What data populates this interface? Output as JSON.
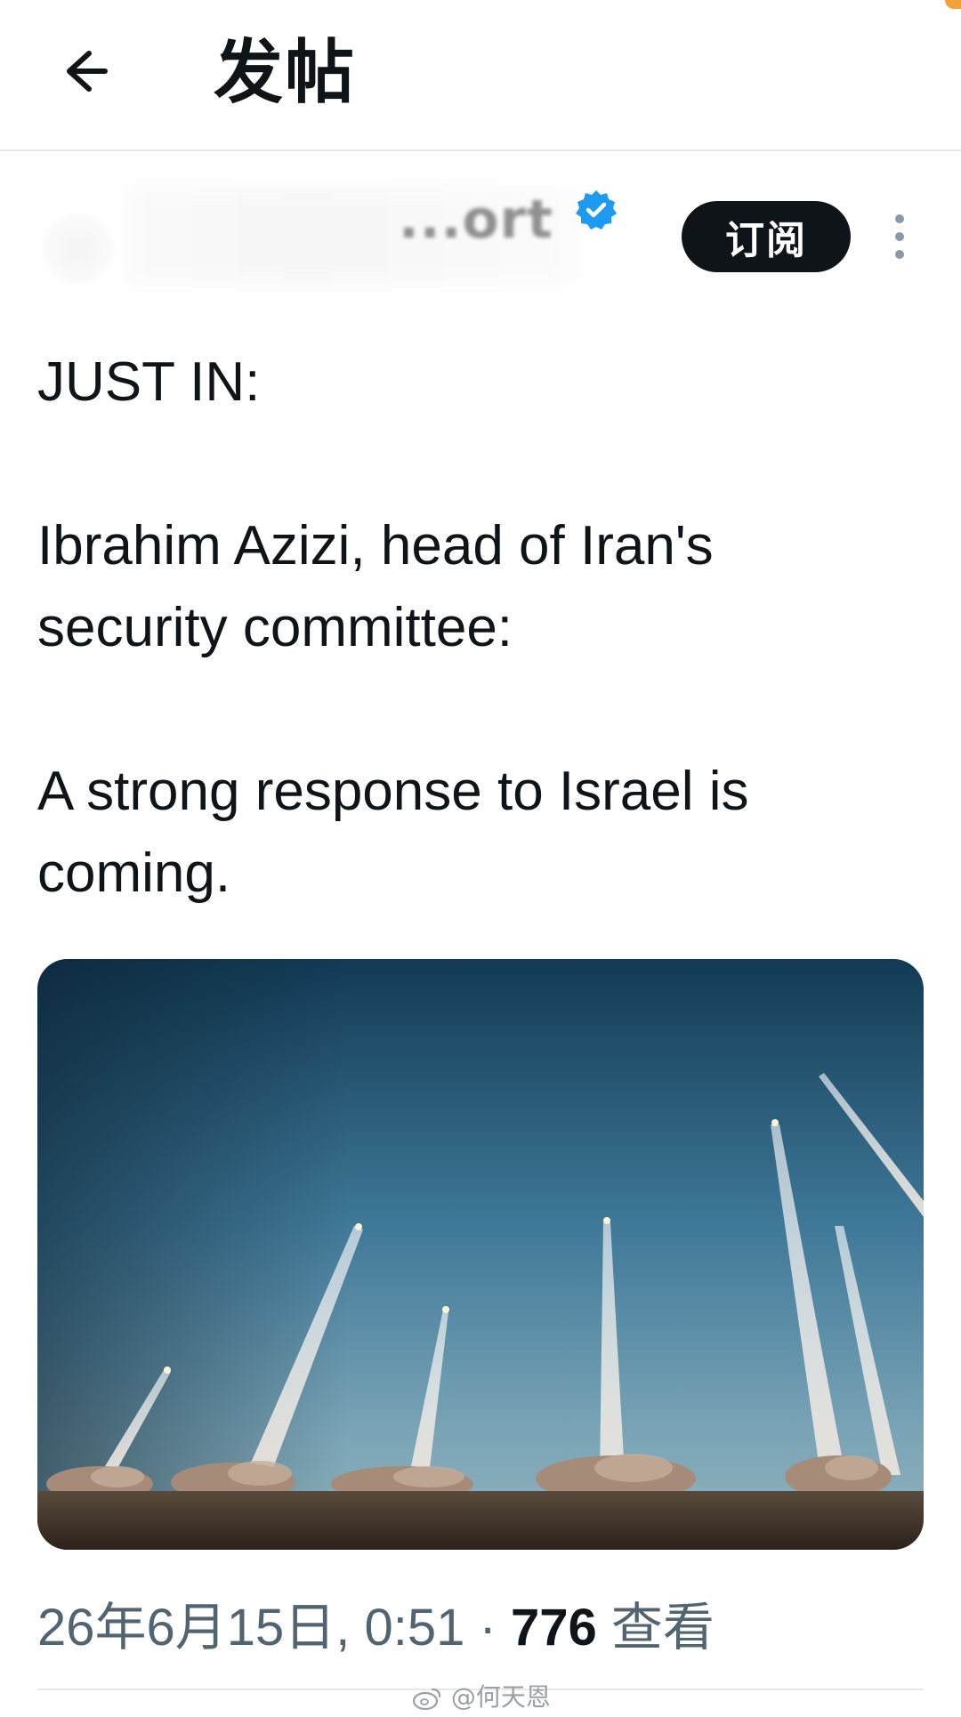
{
  "header": {
    "title": "发帖",
    "back_icon": "arrow-left-icon"
  },
  "author": {
    "display_name": "...ort",
    "verified_icon": "verified-badge-icon",
    "subscribe_label": "订阅",
    "more_icon": "more-vertical-icon"
  },
  "post": {
    "lines": [
      "JUST IN:",
      "Ibrahim Azizi, head of Iran's",
      "security committee:",
      "A strong response to Israel is",
      "coming."
    ]
  },
  "meta": {
    "timestamp": "26年6月15日, 0:51",
    "separator": "·",
    "views_count": "776",
    "views_label": "查看"
  },
  "watermark": {
    "text": "@何天恩",
    "icon": "weibo-icon"
  },
  "colors": {
    "text_primary": "#0f1419",
    "text_secondary": "#536471",
    "verified": "#1d9bf0",
    "button_bg": "#0f1419",
    "divider": "#e6e9eb"
  }
}
